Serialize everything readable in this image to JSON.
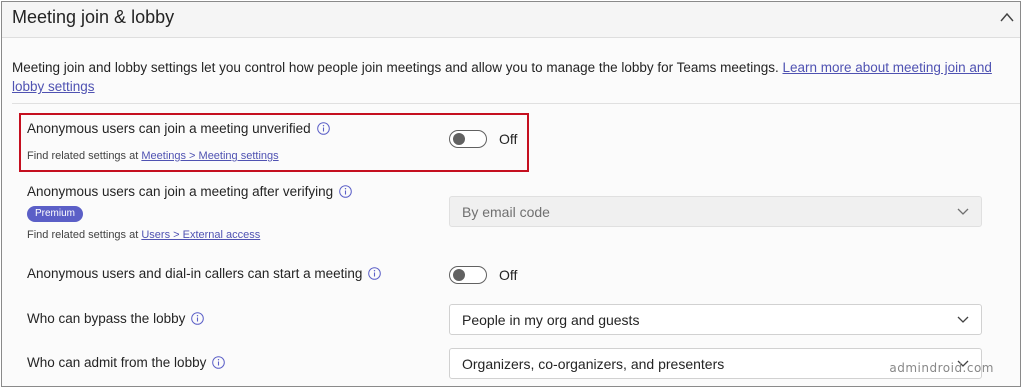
{
  "section": {
    "title": "Meeting join & lobby",
    "description": "Meeting join and lobby settings let you control how people join meetings and allow you to manage the lobby for Teams meetings.",
    "learn_more_link": "Learn more about meeting join and lobby settings"
  },
  "settings": {
    "anon_unverified": {
      "label": "Anonymous users can join a meeting unverified",
      "related_prefix": "Find related settings at",
      "related_link": "Meetings > Meeting settings",
      "toggle_state": "Off"
    },
    "anon_verifying": {
      "label": "Anonymous users can join a meeting after verifying",
      "badge": "Premium",
      "related_prefix": "Find related settings at",
      "related_link": "Users > External access",
      "dropdown_value": "By email code"
    },
    "anon_dialin_start": {
      "label": "Anonymous users and dial-in callers can start a meeting",
      "toggle_state": "Off"
    },
    "bypass_lobby": {
      "label": "Who can bypass the lobby",
      "dropdown_value": "People in my org and guests"
    },
    "admit_lobby": {
      "label": "Who can admit from the lobby",
      "dropdown_value": "Organizers, co-organizers, and presenters"
    }
  },
  "watermark": "admindroid.com",
  "colors": {
    "accent": "#5b5fc7",
    "link": "#4f52b2",
    "highlight_border": "#c50f1f"
  }
}
